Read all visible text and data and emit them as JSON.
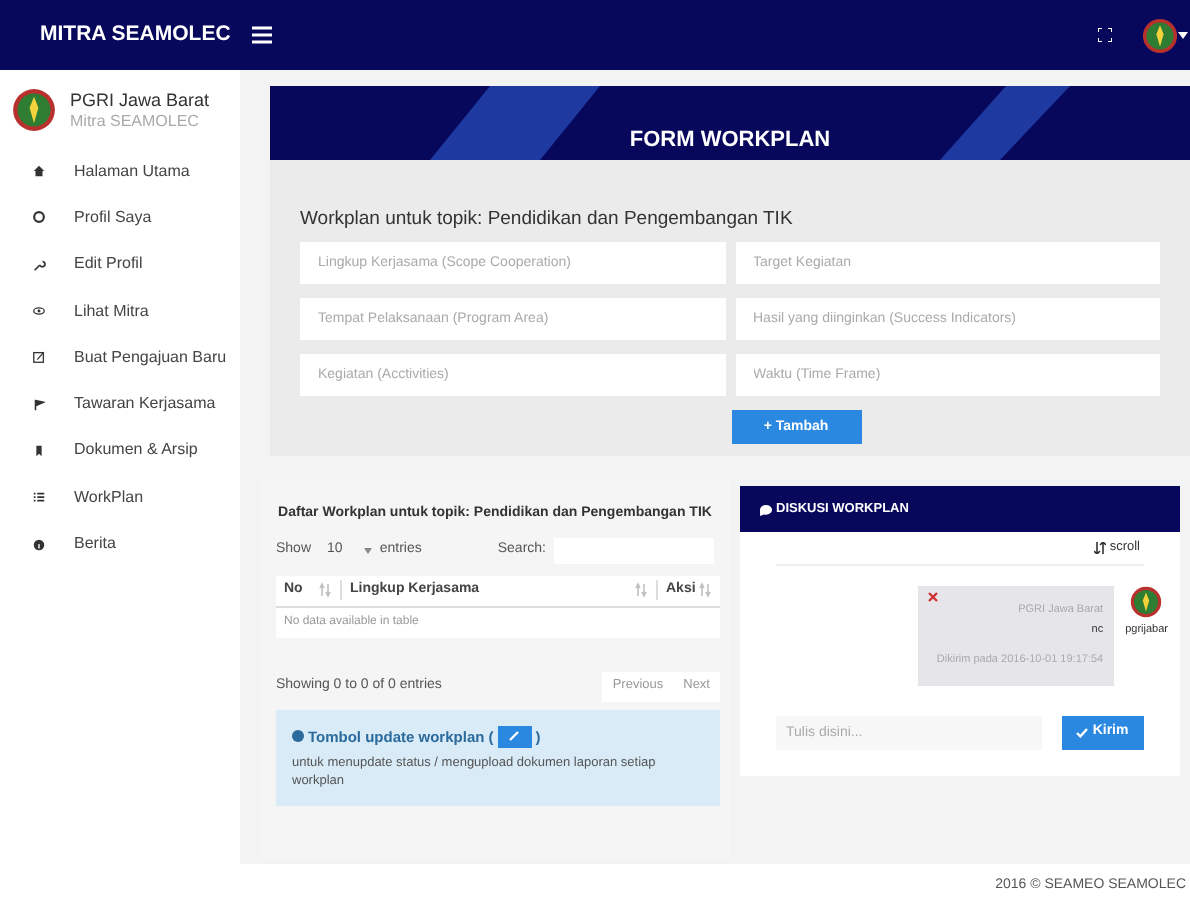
{
  "topbar": {
    "brand": "MITRA SEAMOLEC"
  },
  "profile": {
    "name": "PGRI Jawa Barat",
    "role": "Mitra SEAMOLEC"
  },
  "sidebar": {
    "items": [
      {
        "label": "Halaman Utama"
      },
      {
        "label": "Profil Saya"
      },
      {
        "label": "Edit Profil"
      },
      {
        "label": "Lihat Mitra"
      },
      {
        "label": "Buat Pengajuan Baru"
      },
      {
        "label": "Tawaran Kerjasama"
      },
      {
        "label": "Dokumen & Arsip"
      },
      {
        "label": "WorkPlan"
      },
      {
        "label": "Berita"
      }
    ]
  },
  "form": {
    "banner_title": "FORM WORKPLAN",
    "heading": "Workplan untuk topik: Pendidikan dan Pengembangan TIK",
    "fields": [
      {
        "placeholder": "Lingkup Kerjasama (Scope Cooperation)"
      },
      {
        "placeholder": "Target Kegiatan"
      },
      {
        "placeholder": "Tempat Pelaksanaan (Program Area)"
      },
      {
        "placeholder": "Hasil yang diinginkan (Success Indicators)"
      },
      {
        "placeholder": "Kegiatan (Acctivities)"
      },
      {
        "placeholder": "Waktu (Time Frame)"
      }
    ],
    "add_button": "+ Tambah"
  },
  "list": {
    "title": "Daftar Workplan untuk topik: Pendidikan dan Pengembangan TIK",
    "show_label": "Show",
    "page_size": "10",
    "entries_label": "entries",
    "search_label": "Search:",
    "columns": [
      "No",
      "Lingkup Kerjasama",
      "Aksi"
    ],
    "empty": "No data available in table",
    "info": "Showing 0 to 0 of 0 entries",
    "pagination": [
      "Previous",
      "Next"
    ],
    "note": {
      "title": "Tombol update workplan (",
      "title_end": ")",
      "body": "untuk menupdate status / mengupload dokumen laporan setiap workplan"
    }
  },
  "discussion": {
    "title": "DISKUSI WORKPLAN",
    "scroll_label": "scroll",
    "messages": [
      {
        "sender": "PGRI Jawa Barat",
        "text": "nc",
        "sent": "Dikirim pada 2016-10-01 19:17:54",
        "user": "pgrijabar"
      }
    ],
    "input": {
      "placeholder": "Tulis disini..."
    },
    "send_button": "Kirim"
  },
  "footer": "2016 © SEAMEO SEAMOLEC"
}
